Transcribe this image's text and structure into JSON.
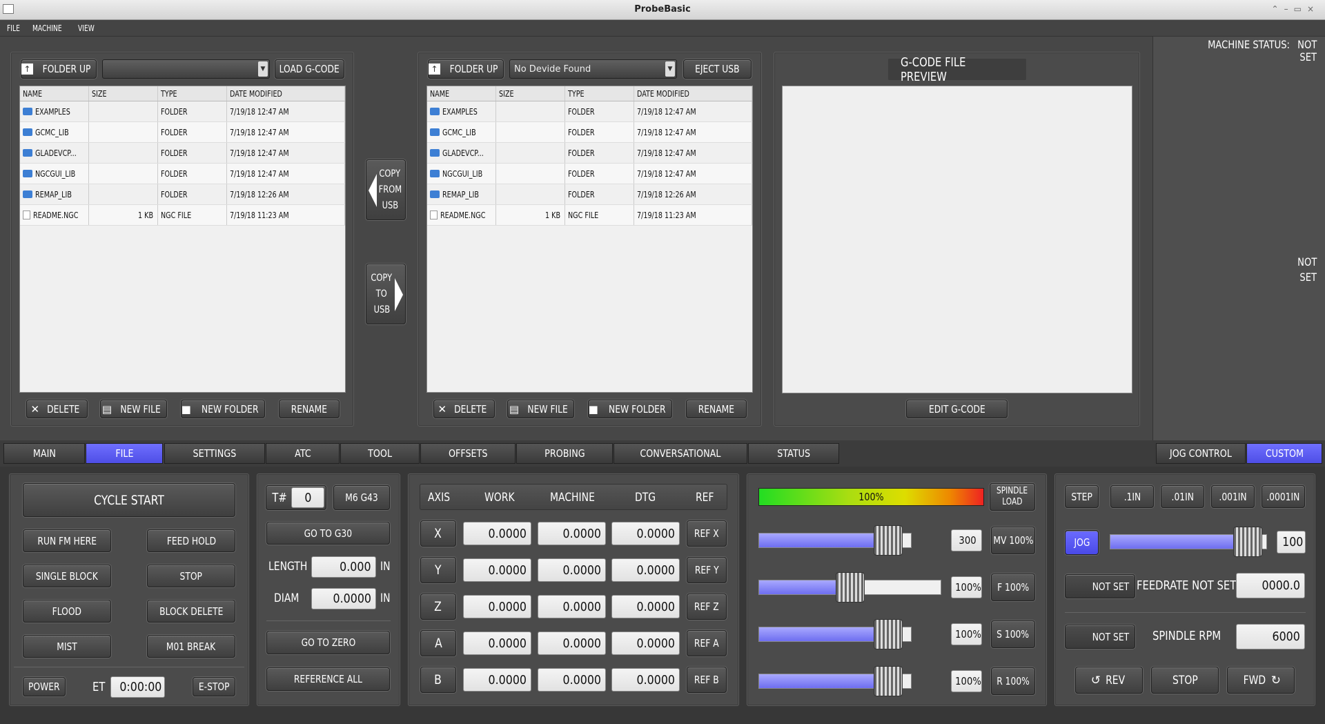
{
  "window": {
    "title": "ProbeBasic"
  },
  "menu": [
    "FILE",
    "MACHINE",
    "VIEW"
  ],
  "file_left": {
    "folder_up": "FOLDER UP",
    "combo_value": "",
    "load_label": "LOAD G-CODE",
    "columns": [
      "NAME",
      "SIZE",
      "TYPE",
      "DATE MODIFIED"
    ],
    "rows": [
      {
        "name": "EXAMPLES",
        "size": "",
        "type": "FOLDER",
        "date": "7/19/18 12:47 AM"
      },
      {
        "name": "GCMC_LIB",
        "size": "",
        "type": "FOLDER",
        "date": "7/19/18 12:47 AM"
      },
      {
        "name": "GLADEVCP...",
        "size": "",
        "type": "FOLDER",
        "date": "7/19/18 12:47 AM"
      },
      {
        "name": "NGCGUI_LIB",
        "size": "",
        "type": "FOLDER",
        "date": "7/19/18 12:47 AM"
      },
      {
        "name": "REMAP_LIB",
        "size": "",
        "type": "FOLDER",
        "date": "7/19/18 12:26 AM"
      },
      {
        "name": "README.NGC",
        "size": "1 KB",
        "type": "NGC FILE",
        "date": "7/19/18 11:23 AM"
      }
    ],
    "delete": "DELETE",
    "new_file": "NEW FILE",
    "new_folder": "NEW FOLDER",
    "rename": "RENAME"
  },
  "copy_from_usb": [
    "COPY",
    "FROM",
    "USB"
  ],
  "copy_to_usb": [
    "COPY",
    "TO",
    "USB"
  ],
  "file_right": {
    "folder_up": "FOLDER UP",
    "combo_value": "No Devide Found",
    "eject_label": "EJECT USB",
    "columns": [
      "NAME",
      "SIZE",
      "TYPE",
      "DATE MODIFIED"
    ],
    "rows": [
      {
        "name": "EXAMPLES",
        "size": "",
        "type": "FOLDER",
        "date": "7/19/18 12:47 AM"
      },
      {
        "name": "GCMC_LIB",
        "size": "",
        "type": "FOLDER",
        "date": "7/19/18 12:47 AM"
      },
      {
        "name": "GLADEVCP...",
        "size": "",
        "type": "FOLDER",
        "date": "7/19/18 12:47 AM"
      },
      {
        "name": "NGCGUI_LIB",
        "size": "",
        "type": "FOLDER",
        "date": "7/19/18 12:47 AM"
      },
      {
        "name": "REMAP_LIB",
        "size": "",
        "type": "FOLDER",
        "date": "7/19/18 12:26 AM"
      },
      {
        "name": "README.NGC",
        "size": "1 KB",
        "type": "NGC FILE",
        "date": "7/19/18 11:23 AM"
      }
    ],
    "delete": "DELETE",
    "new_file": "NEW FILE",
    "new_folder": "NEW FOLDER",
    "rename": "RENAME"
  },
  "preview": {
    "title": "G-CODE FILE PREVIEW",
    "edit": "EDIT G-CODE"
  },
  "status_panel": {
    "machine_status": "MACHINE STATUS:",
    "status_value_1": "NOT",
    "status_value_2": "SET",
    "mid_1": "NOT",
    "mid_2": "SET"
  },
  "tabs": [
    {
      "label": "MAIN",
      "active": false
    },
    {
      "label": "FILE",
      "active": true
    },
    {
      "label": "SETTINGS",
      "active": false
    },
    {
      "label": "ATC",
      "active": false
    },
    {
      "label": "TOOL",
      "active": false
    },
    {
      "label": "OFFSETS",
      "active": false
    },
    {
      "label": "PROBING",
      "active": false
    },
    {
      "label": "CONVERSATIONAL",
      "active": false
    },
    {
      "label": "STATUS",
      "active": false
    }
  ],
  "right_tabs": [
    {
      "label": "JOG CONTROL",
      "active": false
    },
    {
      "label": "CUSTOM",
      "active": true
    }
  ],
  "controls": {
    "cycle_start": "CYCLE START",
    "run_from_here": "RUN FM HERE",
    "feed_hold": "FEED HOLD",
    "single_block": "SINGLE BLOCK",
    "stop": "STOP",
    "flood": "FLOOD",
    "block_delete": "BLOCK DELETE",
    "mist": "MIST",
    "m01_break": "M01 BREAK",
    "power": "POWER",
    "et_label": "ET",
    "et_value": "0:00:00",
    "estop": "E-STOP"
  },
  "tool": {
    "t_label": "T#",
    "t_value": "0",
    "m6": "M6 G43",
    "go_g30": "GO TO G30",
    "length_label": "LENGTH",
    "length_value": "0.000",
    "length_unit": "IN",
    "diam_label": "DIAM",
    "diam_value": "0.0000",
    "diam_unit": "IN",
    "go_zero": "GO TO ZERO",
    "ref_all": "REFERENCE ALL"
  },
  "dro": {
    "headers": [
      "AXIS",
      "WORK",
      "MACHINE",
      "DTG",
      "REF"
    ],
    "axes": [
      {
        "axis": "X",
        "work": "0.0000",
        "machine": "0.0000",
        "dtg": "0.0000",
        "ref": "REF X"
      },
      {
        "axis": "Y",
        "work": "0.0000",
        "machine": "0.0000",
        "dtg": "0.0000",
        "ref": "REF Y"
      },
      {
        "axis": "Z",
        "work": "0.0000",
        "machine": "0.0000",
        "dtg": "0.0000",
        "ref": "REF Z"
      },
      {
        "axis": "A",
        "work": "0.0000",
        "machine": "0.0000",
        "dtg": "0.0000",
        "ref": "REF A"
      },
      {
        "axis": "B",
        "work": "0.0000",
        "machine": "0.0000",
        "dtg": "0.0000",
        "ref": "REF B"
      }
    ]
  },
  "overrides": {
    "spindle_load": "100%",
    "spindle_load_label_1": "SPINDLE",
    "spindle_load_label_2": "LOAD",
    "rows": [
      {
        "value": "300",
        "button": "MV 100%",
        "level": 0.85
      },
      {
        "value": "100%",
        "button": "F 100%",
        "level": 0.5
      },
      {
        "value": "100%",
        "button": "S 100%",
        "level": 0.85
      },
      {
        "value": "100%",
        "button": "R 100%",
        "level": 0.85
      }
    ]
  },
  "jog": {
    "step": "STEP",
    "inc": [
      ".1IN",
      ".01IN",
      ".001IN",
      ".0001IN"
    ],
    "jog": "JOG",
    "jog_value": "100",
    "jog_level": 0.88,
    "not_set_1": "NOT SET",
    "feedrate_label": "FEEDRATE NOT SET/",
    "feedrate_value": "0000.0",
    "not_set_2": "NOT SET",
    "rpm_label": "SPINDLE RPM",
    "rpm_value": "6000",
    "rev": "REV",
    "stop": "STOP",
    "fwd": "FWD"
  },
  "colors": {
    "active_tab": "#5a5af0",
    "load_gradient": [
      "#22dd22",
      "#dddd00",
      "#ee2222"
    ]
  }
}
